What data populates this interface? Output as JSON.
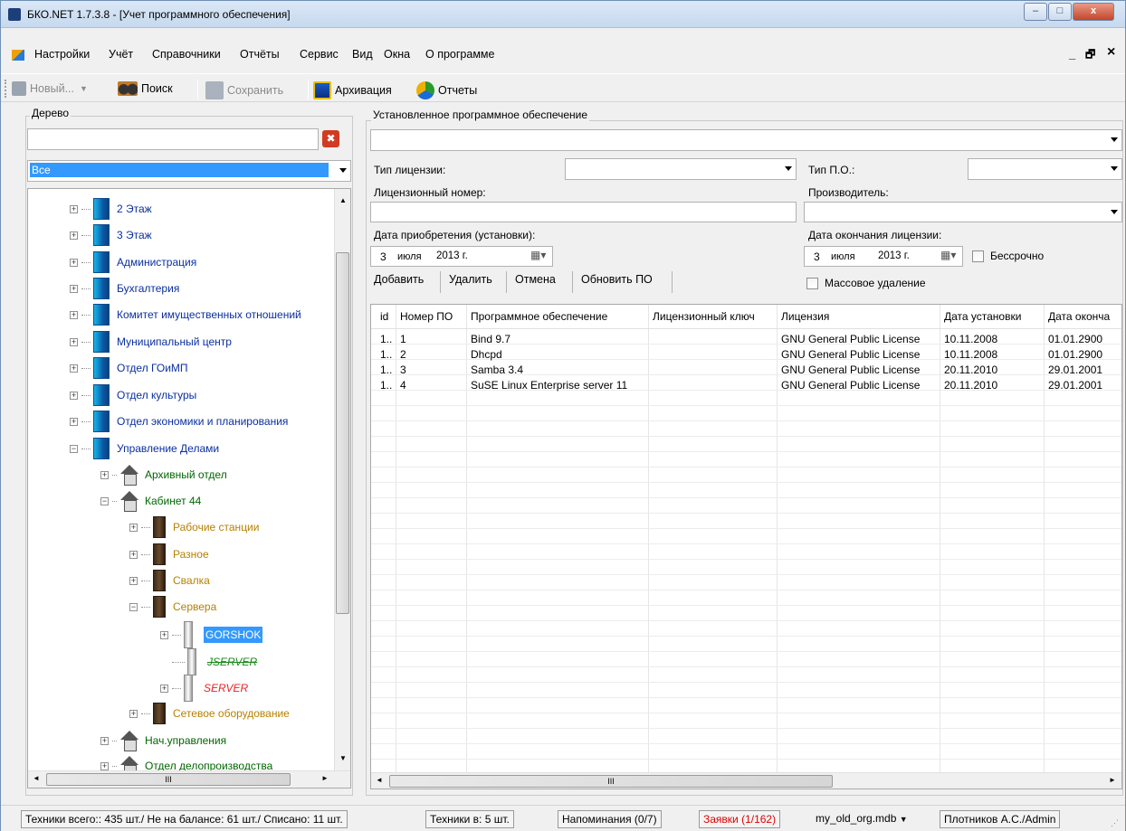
{
  "window": {
    "title": "БКО.NET 1.7.3.8 - [Учет программного обеспечения]",
    "min": "–",
    "max": "□",
    "close": "x"
  },
  "menu": {
    "items": [
      "Настройки",
      "Учёт",
      "Справочники",
      "Отчёты",
      "Сервис",
      "Вид",
      "Окна",
      "О программе"
    ],
    "mdi_min": "_",
    "mdi_restore": "🗗",
    "mdi_close": "×"
  },
  "toolbar": {
    "new_label": "Новый...",
    "search_label": "Поиск",
    "save_label": "Сохранить",
    "archive_label": "Архивация",
    "reports_label": "Отчеты"
  },
  "tree_panel": {
    "group_label": "Дерево",
    "filter_value": "",
    "clear_icon": "✖",
    "scope_value": "Все",
    "nodes": [
      {
        "label": "2 Этаж",
        "color": "#0a2fa0"
      },
      {
        "label": "3 Этаж",
        "color": "#0a2fa0"
      },
      {
        "label": "Администрация",
        "color": "#0a2fa0"
      },
      {
        "label": "Бухгалтерия",
        "color": "#0a2fa0"
      },
      {
        "label": "Комитет имущественных отношений",
        "color": "#0a2fa0"
      },
      {
        "label": "Муниципальный центр",
        "color": "#0a2fa0"
      },
      {
        "label": "Отдел ГОиМП",
        "color": "#0a2fa0"
      },
      {
        "label": "Отдел культуры",
        "color": "#0a2fa0"
      },
      {
        "label": "Отдел экономики и планирования",
        "color": "#0a2fa0"
      },
      {
        "label": "Управление Делами",
        "color": "#0a2fa0"
      },
      {
        "label": "Архивный отдел",
        "color": "#006600"
      },
      {
        "label": "Кабинет 44",
        "color": "#006600"
      },
      {
        "label": "Рабочие станции",
        "color": "#b88000"
      },
      {
        "label": "Разное",
        "color": "#b88000"
      },
      {
        "label": "Свалка",
        "color": "#b88000"
      },
      {
        "label": "Сервера",
        "color": "#b88000"
      },
      {
        "label": "GORSHOK",
        "color": "#ffffff"
      },
      {
        "label": "JSERVER",
        "color": "#1a8a1a"
      },
      {
        "label": "SERVER",
        "color": "#ee2222"
      },
      {
        "label": "Сетевое оборудование",
        "color": "#b88000"
      },
      {
        "label": "Нач.управления",
        "color": "#006600"
      },
      {
        "label": "Отдел делопроизводства",
        "color": "#006600"
      }
    ],
    "hscroll_grip": "III"
  },
  "software_panel": {
    "group_label": "Установленное программное обеспечение",
    "software_value": "",
    "license_type_label": "Тип лицензии:",
    "license_type_value": "",
    "software_type_label": "Тип П.О.:",
    "software_type_value": "",
    "license_number_label": "Лицензионный номер:",
    "license_number_value": "",
    "vendor_label": "Производитель:",
    "vendor_value": "",
    "purchase_date_label": "Дата приобретения (установки):",
    "purchase_date": {
      "day": "3",
      "month": "июля",
      "year": "2013 г."
    },
    "expiry_date_label": "Дата окончания лицензии:",
    "expiry_date": {
      "day": "3",
      "month": "июля",
      "year": "2013 г."
    },
    "perpetual_label": "Бессрочно",
    "mass_delete_label": "Массовое удаление",
    "buttons": {
      "add": "Добавить",
      "delete": "Удалить",
      "cancel": "Отмена",
      "refresh": "Обновить ПО"
    },
    "grid": {
      "columns": [
        "id",
        "Номер ПО",
        "Программное обеспечение",
        "Лицензионный ключ",
        "Лицензия",
        "Дата установки",
        "Дата оконча"
      ],
      "rows": [
        [
          "1..",
          "1",
          "Bind 9.7",
          "",
          "GNU General Public License",
          "10.11.2008",
          "01.01.2900"
        ],
        [
          "1..",
          "2",
          "Dhcpd",
          "",
          "GNU General Public License",
          "10.11.2008",
          "01.01.2900"
        ],
        [
          "1..",
          "3",
          "Samba 3.4",
          "",
          "GNU General Public License",
          "20.11.2010",
          "29.01.2001"
        ],
        [
          "1..",
          "4",
          "SuSE Linux Enterprise server 11",
          "",
          "GNU General Public License",
          "20.11.2010",
          "29.01.2001"
        ]
      ],
      "hscroll_grip": "III"
    }
  },
  "statusbar": {
    "equipment_total": "Техники всего:: 435 шт./ Не на балансе: 61 шт./ Списано: 11 шт.",
    "equipment_in": "Техники в:  5 шт.",
    "reminders": "Напоминания (0/7)",
    "requests": "Заявки (1/162)",
    "database": "my_old_org.mdb",
    "user": "Плотников А.С./Admin"
  },
  "colors": {
    "selection": "#3399ff",
    "requests_red": "#e00000"
  }
}
